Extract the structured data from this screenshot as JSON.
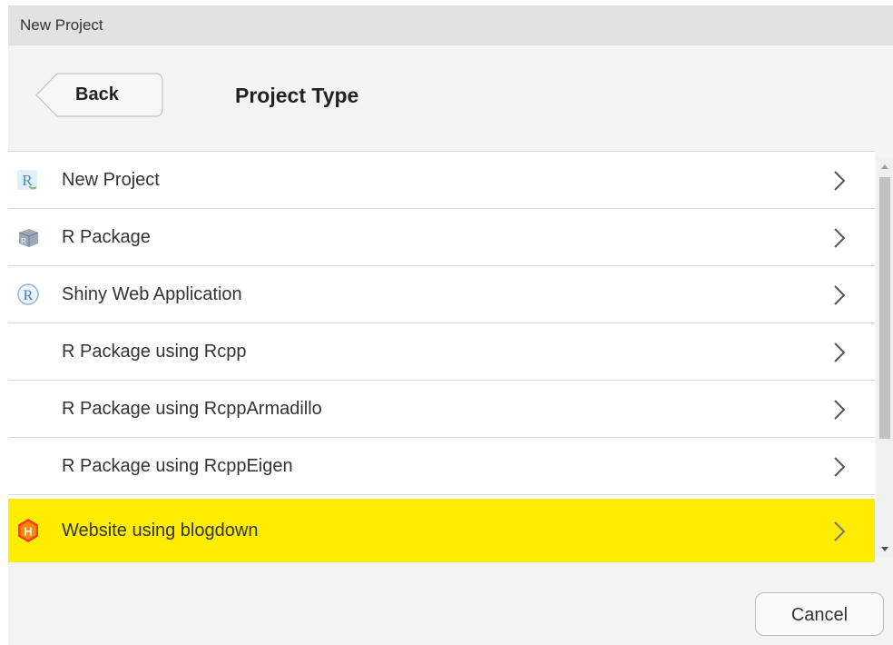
{
  "window": {
    "title": "New Project"
  },
  "header": {
    "back_label": "Back",
    "heading": "Project Type"
  },
  "project_types": [
    {
      "label": "New Project",
      "icon": "r-project-icon"
    },
    {
      "label": "R Package",
      "icon": "r-package-icon"
    },
    {
      "label": "Shiny Web Application",
      "icon": "shiny-icon"
    },
    {
      "label": "R Package using Rcpp",
      "icon": ""
    },
    {
      "label": "R Package using RcppArmadillo",
      "icon": ""
    },
    {
      "label": "R Package using RcppEigen",
      "icon": ""
    },
    {
      "label": "Website using blogdown",
      "icon": "hugo-icon"
    }
  ],
  "footer": {
    "cancel_label": "Cancel"
  },
  "colors": {
    "highlight": "#ffed00",
    "hugo": "#ff4088"
  }
}
